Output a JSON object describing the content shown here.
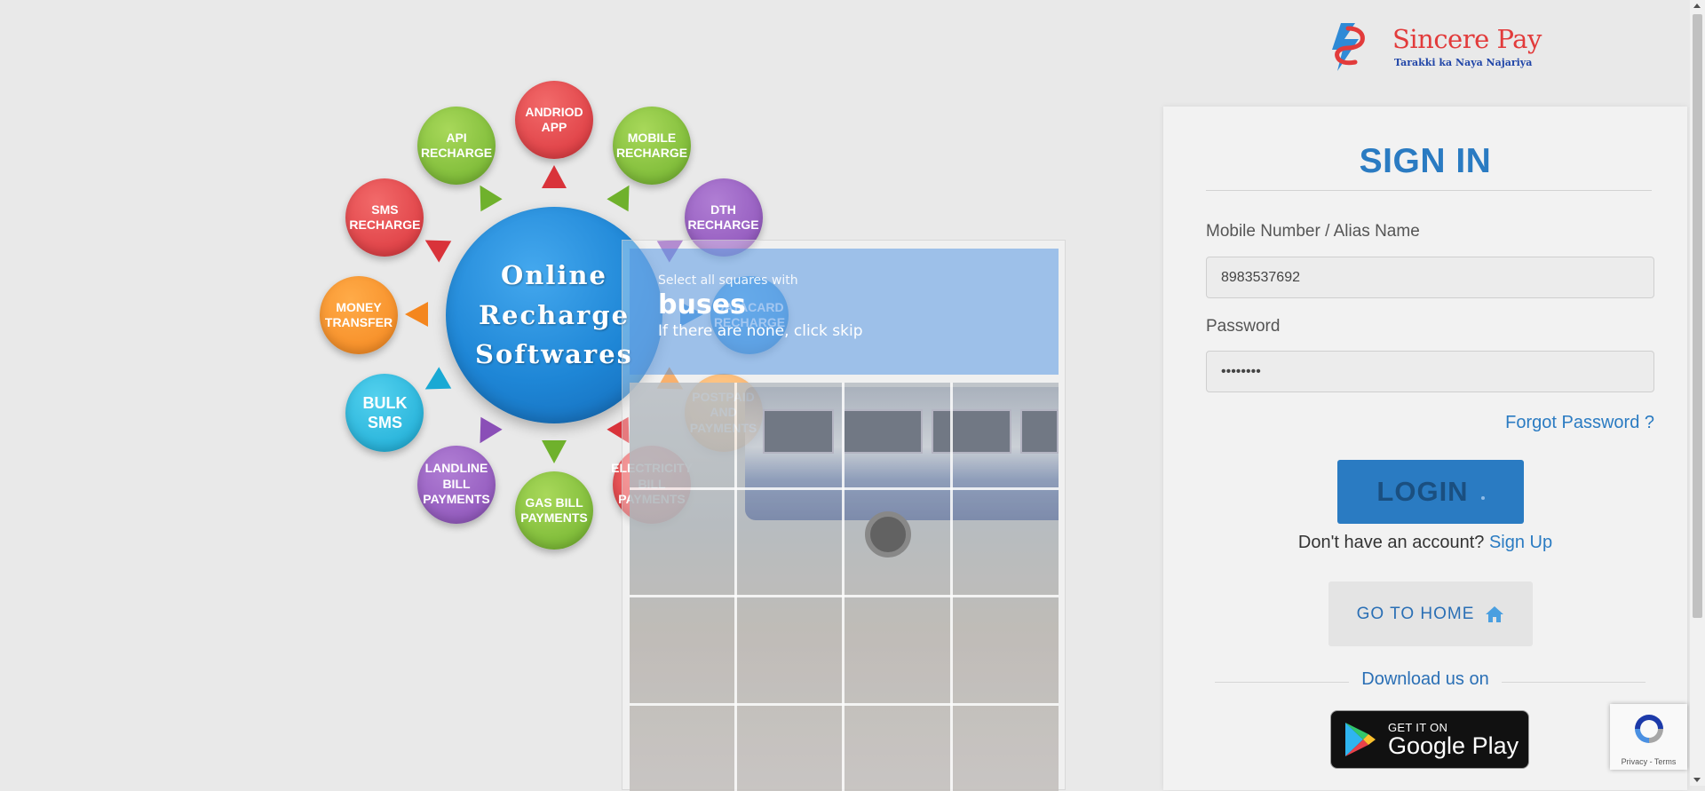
{
  "brand": {
    "name": "Sincere Pay",
    "tagline": "Tarakki ka Naya Najariya",
    "primary_color": "#2a7bc2",
    "logo_red": "#e23b3b"
  },
  "infographic": {
    "hub_lines": [
      "Online",
      "Recharge",
      "Softwares"
    ],
    "bubbles": [
      {
        "label": "ANDRIOD\nAPP",
        "color": "red"
      },
      {
        "label": "MOBILE\nRECHARGE",
        "color": "green"
      },
      {
        "label": "DTH\nRECHARGE",
        "color": "purple"
      },
      {
        "label": "DATACARD\nRECHARGE",
        "color": "blue"
      },
      {
        "label": "POSTPAID\nAND\nPAYMENTS",
        "color": "orange"
      },
      {
        "label": "ELECTRICITY\nBILL\nPAYMENTS",
        "color": "red"
      },
      {
        "label": "GAS BILL\nPAYMENTS",
        "color": "green"
      },
      {
        "label": "LANDLINE\nBILL\nPAYMENTS",
        "color": "purple"
      },
      {
        "label": "BULK SMS",
        "color": "cyan"
      },
      {
        "label": "MONEY\nTRANSFER",
        "color": "orange"
      },
      {
        "label": "SMS\nRECHARGE",
        "color": "red"
      },
      {
        "label": "API\nRECHARGE",
        "color": "green"
      }
    ]
  },
  "captcha": {
    "instruction": "Select all squares with",
    "target": "buses",
    "hint": "If there are none, click skip"
  },
  "signin": {
    "title": "SIGN IN",
    "mobile_label": "Mobile Number / Alias Name",
    "mobile_value": "8983537692",
    "password_label": "Password",
    "password_value": "••••••••",
    "forgot": "Forgot Password ?",
    "login": "LOGIN",
    "no_account": "Don't have an account?",
    "sign_up": "Sign Up",
    "go_home": "GO TO HOME",
    "download": "Download us on",
    "gplay_small": "GET IT ON",
    "gplay_big": "Google Play"
  },
  "recaptcha": {
    "links": "Privacy - Terms"
  }
}
